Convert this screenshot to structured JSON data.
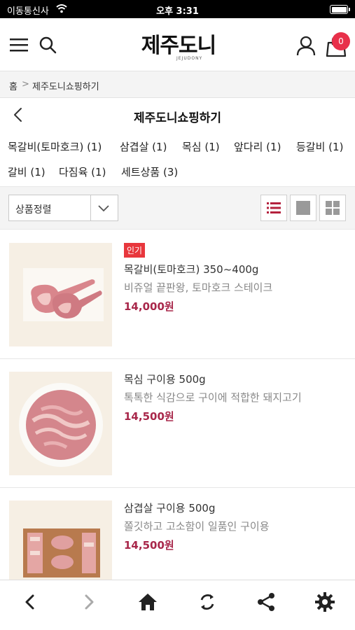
{
  "status_bar": {
    "carrier": "이동통신사",
    "time": "오후 3:31"
  },
  "header": {
    "logo_text": "제주도니",
    "logo_sub": "JEJUDONY",
    "cart_count": "0",
    "accent_color": "#e8304a"
  },
  "breadcrumb": {
    "home": "홈",
    "separator": ">",
    "current": "제주도니쇼핑하기"
  },
  "title_bar": {
    "title": "제주도니쇼핑하기"
  },
  "categories": [
    "목갈비(토마호크) (1)",
    "삼겹살 (1)",
    "목심 (1)",
    "앞다리 (1)",
    "등갈비 (1)",
    "갈비 (1)",
    "다짐육 (1)",
    "세트상품 (3)"
  ],
  "sort": {
    "selected": "상품정렬",
    "view_active": "list"
  },
  "products": [
    {
      "badge": "인기",
      "name": "목갈비(토마호크) 350~400g",
      "desc": "비쥬얼 끝판왕, 토마호크 스테이크",
      "price": "14,000원"
    },
    {
      "badge": "",
      "name": "목심 구이용 500g",
      "desc": "톡톡한 식감으로 구이에 적합한 돼지고기",
      "price": "14,500원"
    },
    {
      "badge": "",
      "name": "삼겹살 구이용 500g",
      "desc": "쫄깃하고 고소함이 일품인 구이용",
      "price": "14,500원"
    }
  ],
  "colors": {
    "price": "#a8274a",
    "badge": "#e8373d",
    "view_active": "#b4213d"
  }
}
